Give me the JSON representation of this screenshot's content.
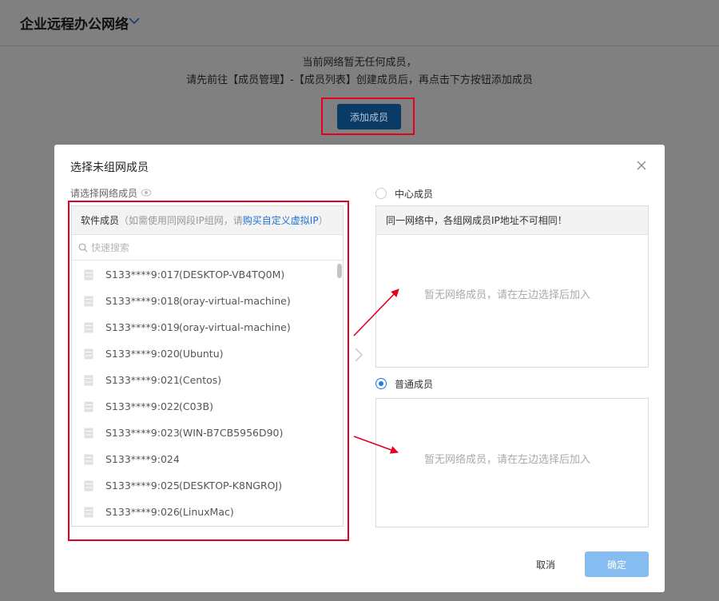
{
  "page": {
    "title": "企业远程办公网络",
    "empty_line1": "当前网络暂无任何成员，",
    "empty_line2": "请先前往【成员管理】-【成员列表】创建成员后，再点击下方按钮添加成员",
    "add_button": "添加成员"
  },
  "dialog": {
    "title": "选择未组网成员",
    "left_label": "请选择网络成员",
    "panel_type": "软件成员",
    "panel_hint": "（如需使用同网段IP组网，请",
    "panel_link": "购买自定义虚拟IP",
    "panel_hint_end": "）",
    "search_placeholder": "快速搜索",
    "members": [
      {
        "id": "S133****9:017",
        "name": "(DESKTOP-VB4TQ0M)"
      },
      {
        "id": "S133****9:018",
        "name": "(oray-virtual-machine)"
      },
      {
        "id": "S133****9:019",
        "name": "(oray-virtual-machine)"
      },
      {
        "id": "S133****9:020",
        "name": "(Ubuntu)"
      },
      {
        "id": "S133****9:021",
        "name": "(Centos)"
      },
      {
        "id": "S133****9:022",
        "name": "(C03B)"
      },
      {
        "id": "S133****9:023",
        "name": "(WIN-B7CB5956D90)"
      },
      {
        "id": "S133****9:024",
        "name": ""
      },
      {
        "id": "S133****9:025",
        "name": "(DESKTOP-K8NGROJ)"
      },
      {
        "id": "S133****9:026",
        "name": "(LinuxMac)"
      }
    ],
    "center": {
      "label": "中心成员",
      "selected": false,
      "notice": "同一网络中，各组网成员IP地址不可相同！",
      "empty": "暂无网络成员，请在左边选择后加入"
    },
    "normal": {
      "label": "普通成员",
      "selected": true,
      "empty": "暂无网络成员，请在左边选择后加入"
    },
    "cancel": "取消",
    "confirm": "确定"
  },
  "colors": {
    "accent": "#1e7be0",
    "link": "#1f72d4",
    "annotation": "#e5001f",
    "confirm_disabled": "#86bcf0"
  }
}
